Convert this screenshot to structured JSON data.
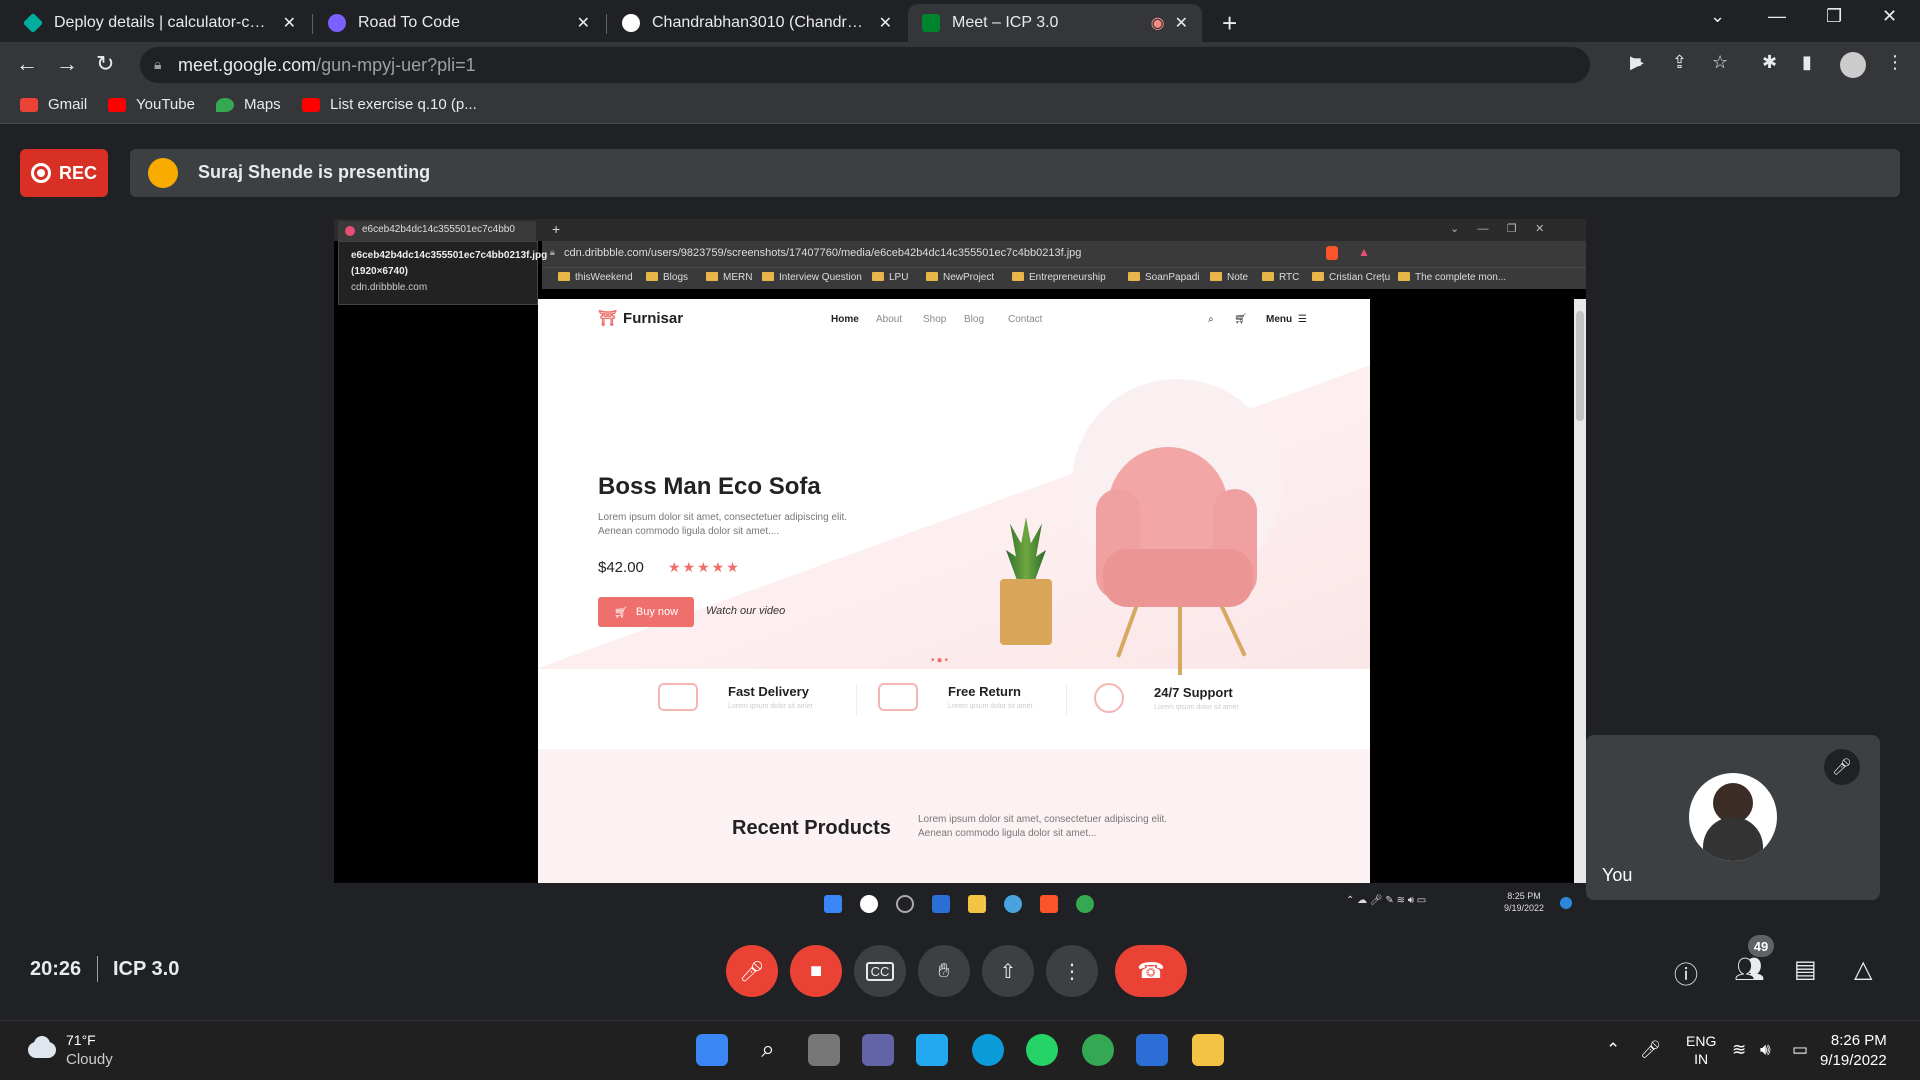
{
  "browser": {
    "tabs": [
      {
        "title": "Deploy details | calculator-chand",
        "favicon_color": "#00ad9f"
      },
      {
        "title": "Road To Code",
        "favicon_color": "#7b61ff"
      },
      {
        "title": "Chandrabhan3010 (Chandrabhan",
        "favicon_color": "#ffffff"
      },
      {
        "title": "Meet – ICP 3.0",
        "favicon_color": "#00832d",
        "active": true
      }
    ],
    "new_tab_symbol": "+",
    "url_host": "meet.google.com",
    "url_path": "/gun-mpyj-uer?pli=1",
    "bookmarks": [
      {
        "label": "Gmail",
        "icon": "gmail-icon",
        "color": "#ea4335"
      },
      {
        "label": "YouTube",
        "icon": "youtube-icon",
        "color": "#ff0000"
      },
      {
        "label": "Maps",
        "icon": "maps-icon",
        "color": "#34a853"
      },
      {
        "label": "List exercise q.10 (p...",
        "icon": "youtube-icon",
        "color": "#ff0000"
      }
    ]
  },
  "meet": {
    "rec_label": "REC",
    "presenting_text": "Suraj Shende is presenting",
    "time": "20:26",
    "meeting_name": "ICP 3.0",
    "participants_count": "49",
    "self_label": "You",
    "colors": {
      "danger": "#ea4335",
      "surface": "#3c4043",
      "background": "#202124"
    }
  },
  "shared": {
    "tab_title": "e6ceb42b4dc14c355501ec7c4bb0",
    "tooltip_title": "e6ceb42b4dc14c355501ec7c4bb0213f.jpg (1920×6740)",
    "tooltip_domain": "cdn.dribbble.com",
    "address": "cdn.dribbble.com/users/9823759/screenshots/17407760/media/e6ceb42b4dc14c355501ec7c4bb0213f.jpg",
    "bookmarks": [
      "thisWeekend",
      "Blogs",
      "MERN",
      "Interview Question",
      "LPU",
      "NewProject",
      "Entrepreneurship",
      "SoanPapadi",
      "Note",
      "RTC",
      "Cristian Crețu",
      "The complete mon..."
    ],
    "site": {
      "brand": "Furnisar",
      "nav": [
        "Home",
        "About",
        "Shop",
        "Blog",
        "Contact"
      ],
      "menu": "Menu",
      "title": "Boss Man Eco Sofa",
      "desc": "Lorem ipsum dolor sit amet, consectetuer adipiscing elit. Aenean commodo ligula dolor sit amet....",
      "price": "$42.00",
      "rating": 5,
      "stars": "★★★★★",
      "buy": "Buy now",
      "watch": "Watch our video",
      "features": [
        {
          "title": "Fast Delivery",
          "sub": "Lorem ipsum dolor sit amet"
        },
        {
          "title": "Free Return",
          "sub": "Lorem ipsum dolor sit amet"
        },
        {
          "title": "24/7 Support",
          "sub": "Lorem ipsum dolor sit amet"
        }
      ],
      "recent_title": "Recent Products",
      "recent_desc": "Lorem ipsum dolor sit amet, consectetuer adipiscing elit. Aenean commodo ligula dolor sit amet...",
      "accent": "#ef6f6c"
    },
    "taskbar_time": "8:25 PM",
    "taskbar_date": "9/19/2022"
  },
  "windows": {
    "temperature": "71°F",
    "condition": "Cloudy",
    "lang_top": "ENG",
    "lang_bottom": "IN",
    "time": "8:26 PM",
    "date": "9/19/2022"
  }
}
